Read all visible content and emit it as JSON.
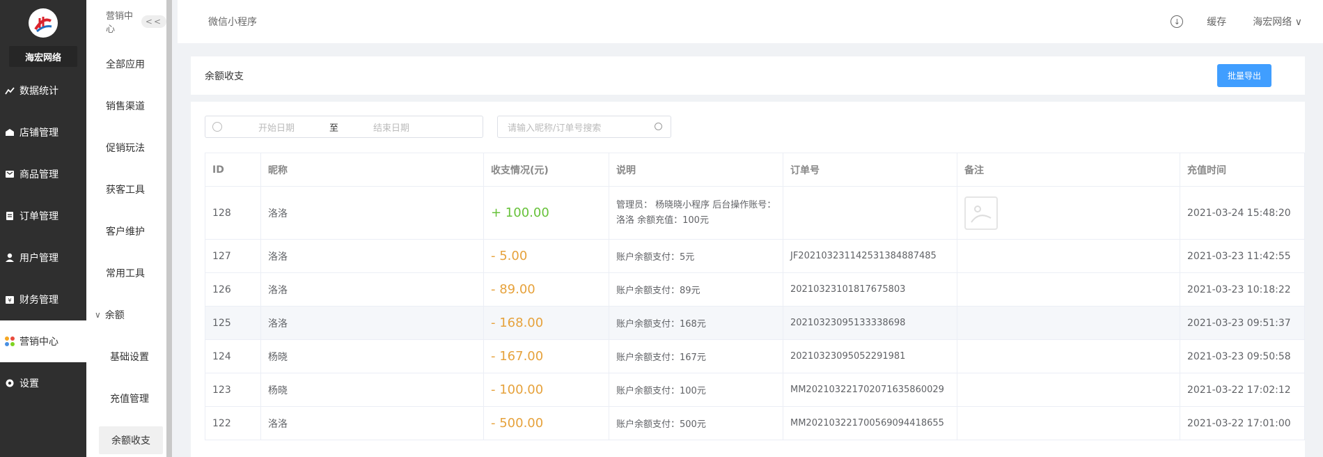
{
  "brand": {
    "name": "海宏网络"
  },
  "sidebar": {
    "items": [
      {
        "label": "数据统计",
        "icon": "chart-icon"
      },
      {
        "label": "店铺管理",
        "icon": "shop-icon"
      },
      {
        "label": "商品管理",
        "icon": "goods-icon"
      },
      {
        "label": "订单管理",
        "icon": "order-icon"
      },
      {
        "label": "用户管理",
        "icon": "user-icon"
      },
      {
        "label": "财务管理",
        "icon": "finance-icon"
      },
      {
        "label": "营销中心",
        "icon": "marketing-icon"
      },
      {
        "label": "设置",
        "icon": "settings-icon"
      }
    ]
  },
  "subbar": {
    "title": "营销中心",
    "collapse": "<<",
    "items": [
      "全部应用",
      "销售渠道",
      "促销玩法",
      "获客工具",
      "客户维护",
      "常用工具"
    ],
    "group": "余额",
    "children": [
      "基础设置",
      "充值管理",
      "余额收支"
    ]
  },
  "topbar": {
    "title": "微信小程序",
    "cache": "缓存",
    "user": "海宏网络"
  },
  "panel": {
    "title": "余额收支",
    "export": "批量导出"
  },
  "filters": {
    "start": "开始日期",
    "sep": "至",
    "end": "结束日期",
    "search_placeholder": "请输入昵称/订单号搜索"
  },
  "table": {
    "headers": [
      "ID",
      "昵称",
      "收支情况(元)",
      "说明",
      "订单号",
      "备注",
      "充值时间"
    ],
    "rows": [
      {
        "id": "128",
        "name": "洛洛",
        "amount": "+ 100.00",
        "desc": "管理员： 杨晓晓小程序 后台操作账号：洛洛 余额充值：100元",
        "order": "",
        "time": "2021-03-24 15:48:20"
      },
      {
        "id": "127",
        "name": "洛洛",
        "amount": "- 5.00",
        "desc": "账户余额支付：5元",
        "order": "JF20210323114253138488​7485",
        "time": "2021-03-23 11:42:55"
      },
      {
        "id": "126",
        "name": "洛洛",
        "amount": "- 89.00",
        "desc": "账户余额支付：89元",
        "order": "20210323101817675803",
        "time": "2021-03-23 10:18:22"
      },
      {
        "id": "125",
        "name": "洛洛",
        "amount": "- 168.00",
        "desc": "账户余额支付：168元",
        "order": "20210323095133338698",
        "time": "2021-03-23 09:51:37"
      },
      {
        "id": "124",
        "name": "杨晓",
        "amount": "- 167.00",
        "desc": "账户余额支付：167元",
        "order": "20210323095052291981",
        "time": "2021-03-23 09:50:58"
      },
      {
        "id": "123",
        "name": "杨晓",
        "amount": "- 100.00",
        "desc": "账户余额支付：100元",
        "order": "MM20210322170207163586​0029",
        "time": "2021-03-22 17:02:12"
      },
      {
        "id": "122",
        "name": "洛洛",
        "amount": "- 500.00",
        "desc": "账户余额支付：500元",
        "order": "MM20210322170056909441​8655",
        "time": "2021-03-22 17:01:00"
      }
    ]
  }
}
